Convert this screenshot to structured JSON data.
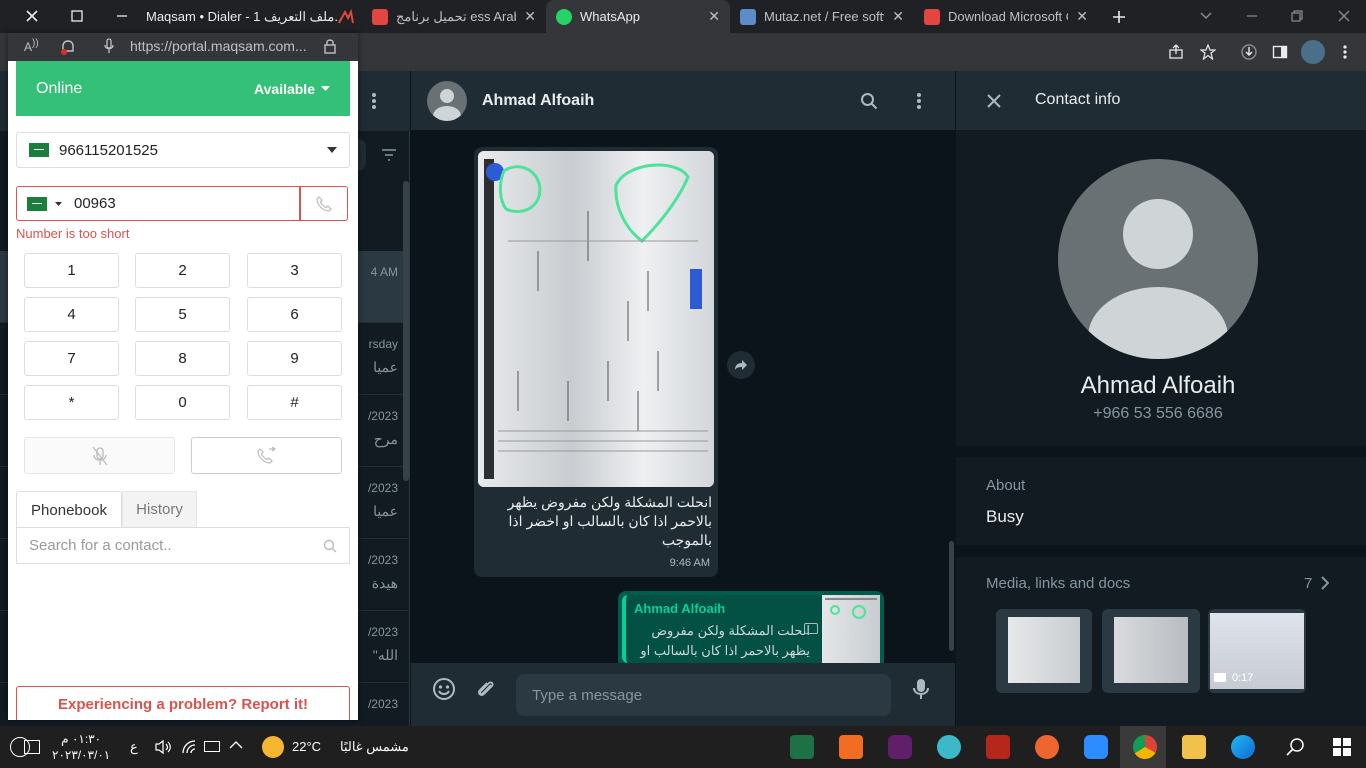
{
  "browser": {
    "tabs": [
      {
        "title": "Maqsam • Dialer - ملف التعريف 1...",
        "active": false
      },
      {
        "title": "تحميل برنامج ess Arabic",
        "active": false
      },
      {
        "title": "WhatsApp",
        "active": true
      },
      {
        "title": "Mutaz.net / Free softw",
        "active": false
      },
      {
        "title": "Download Microsoft O",
        "active": false
      }
    ],
    "popup_url": "https://portal.maqsam.com...",
    "popup_title": "Maqsam • Dialer - ملف التعريف 1..."
  },
  "dialer": {
    "status": "Online",
    "availability": "Available",
    "caller_id": "966115201525",
    "dial_value": "00963",
    "error": "Number is too short",
    "keys": [
      "1",
      "2",
      "3",
      "4",
      "5",
      "6",
      "7",
      "8",
      "9",
      "*",
      "0",
      "#"
    ],
    "tabs": [
      "Phonebook",
      "History"
    ],
    "search_placeholder": "Search for a contact..",
    "report": "Experiencing a problem? Report it!"
  },
  "whatsapp": {
    "chat_list": [
      {
        "time": "4 AM",
        "preview": ""
      },
      {
        "time": "rsday",
        "preview": "عميا"
      },
      {
        "time": "/2023",
        "preview": "مرح"
      },
      {
        "time": "/2023",
        "preview": "عميا"
      },
      {
        "time": "/2023",
        "preview": "هيدة"
      },
      {
        "time": "/2023",
        "preview": "\"الله"
      },
      {
        "time": "/2023",
        "preview": ""
      }
    ],
    "contact_name": "Ahmad Alfoaih",
    "messages": [
      {
        "text": "انحلت المشكلة ولكن مفروض يظهر بالاحمر اذا كان بالسالب او اخضر اذا بالموجب",
        "time": "9:46 AM"
      }
    ],
    "reply": {
      "author": "Ahmad Alfoaih",
      "quote_line1": "انحلت المشكلة ولكن مفروض",
      "quote_line2": "يظهر بالاحمر اذا كان بالسالب او"
    },
    "compose_placeholder": "Type a message",
    "info": {
      "header": "Contact info",
      "name": "Ahmad Alfoaih",
      "phone": "+966 53 556 6686",
      "about_label": "About",
      "about": "Busy",
      "media_label": "Media, links and docs",
      "media_count": "7",
      "video_duration": "0:17"
    }
  },
  "taskbar": {
    "time": "٠١:٣٠ م",
    "date": "٢٠٢٣/٠٣/٠١",
    "lang": "ع",
    "weather_temp": "22°C",
    "weather_desc": "مشمس غالبًا"
  }
}
